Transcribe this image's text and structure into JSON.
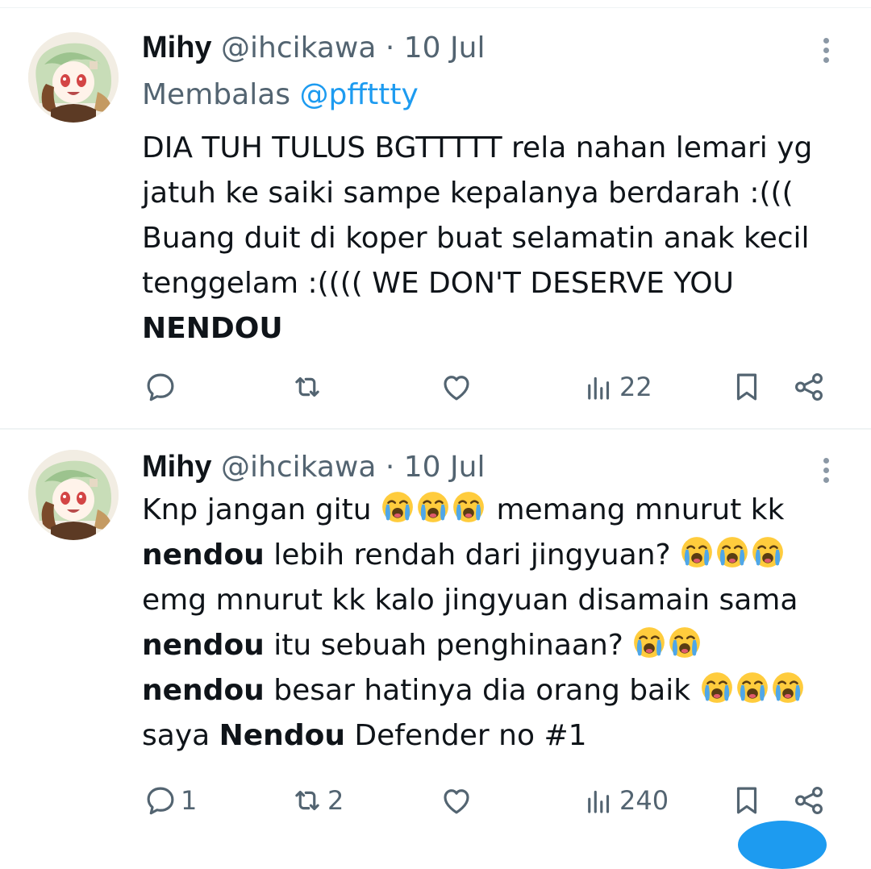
{
  "tweets": [
    {
      "name": "Mihy",
      "handle": "@ihcikawa",
      "separator": "·",
      "time": "10 Jul",
      "reply_prefix": "Membalas",
      "reply_to": "@pffttty",
      "body_text": "DIA TUH TULUS BGTTTTT rela nahan lemari yg jatuh ke saiki sampe kepalanya berdarah :((( Buang duit di koper buat selamatin anak kecil tenggelam :(((( WE DON'T DESERVE YOU",
      "body_bold": "NENDOU",
      "replies": "",
      "retweets": "",
      "views": "22"
    },
    {
      "name": "Mihy",
      "handle": "@ihcikawa",
      "separator": "·",
      "time": "10 Jul",
      "line1": "Knp jangan gitu",
      "line1b": "memang mnurut kk",
      "bold1": "nendou",
      "line2": "lebih rendah dari jingyuan?",
      "line3": "emg mnurut kk kalo jingyuan disamain sama",
      "bold2": "nendou",
      "line4": "itu sebuah penghinaan?",
      "bold3": "nendou",
      "line5": "besar hatinya dia orang baik",
      "line6a": "saya",
      "bold4": "Nendou",
      "line6b": "Defender no #1",
      "replies": "1",
      "retweets": "2",
      "views": "240"
    }
  ],
  "icons": {
    "reply": "reply-icon",
    "retweet": "retweet-icon",
    "like": "heart-icon",
    "views": "views-icon",
    "bookmark": "bookmark-icon",
    "share": "share-icon",
    "more": "more-icon",
    "emoji": "loudly-crying-face"
  },
  "colors": {
    "text": "#0f1419",
    "muted": "#536471",
    "link": "#1d9bf0",
    "divider": "#eff3f4"
  }
}
